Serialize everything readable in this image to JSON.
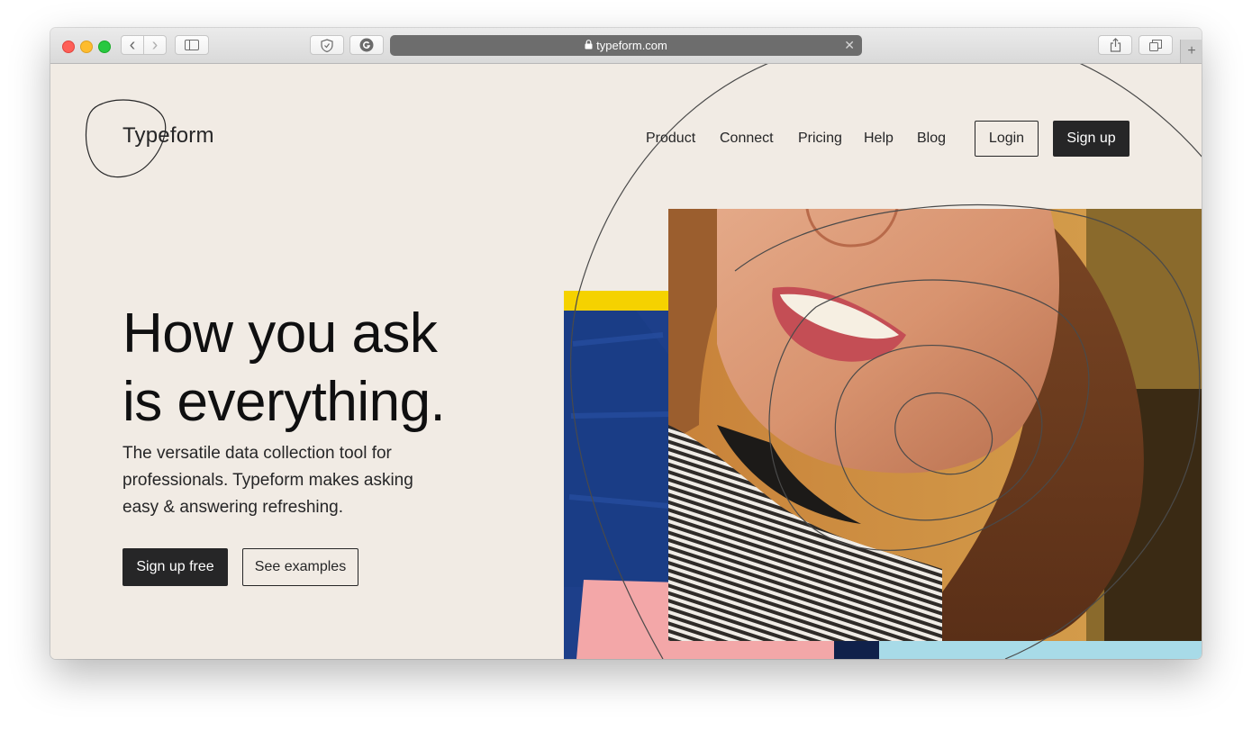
{
  "browser": {
    "url": "typeform.com",
    "controls": {
      "back": "‹",
      "forward": "›",
      "new_tab": "+"
    }
  },
  "header": {
    "logo": "Typeform",
    "nav": [
      "Product",
      "Connect",
      "Pricing",
      "Help",
      "Blog"
    ],
    "login": "Login",
    "signup": "Sign up"
  },
  "hero": {
    "headline_line1": "How you ask",
    "headline_line2": "is everything.",
    "subtitle": "The versatile data collection tool for professionals. Typeform makes asking easy & answering refreshing.",
    "primary_cta": "Sign up free",
    "secondary_cta": "See examples"
  },
  "colors": {
    "background": "#f1ebe4",
    "text": "#262627",
    "dark_button": "#262627"
  }
}
